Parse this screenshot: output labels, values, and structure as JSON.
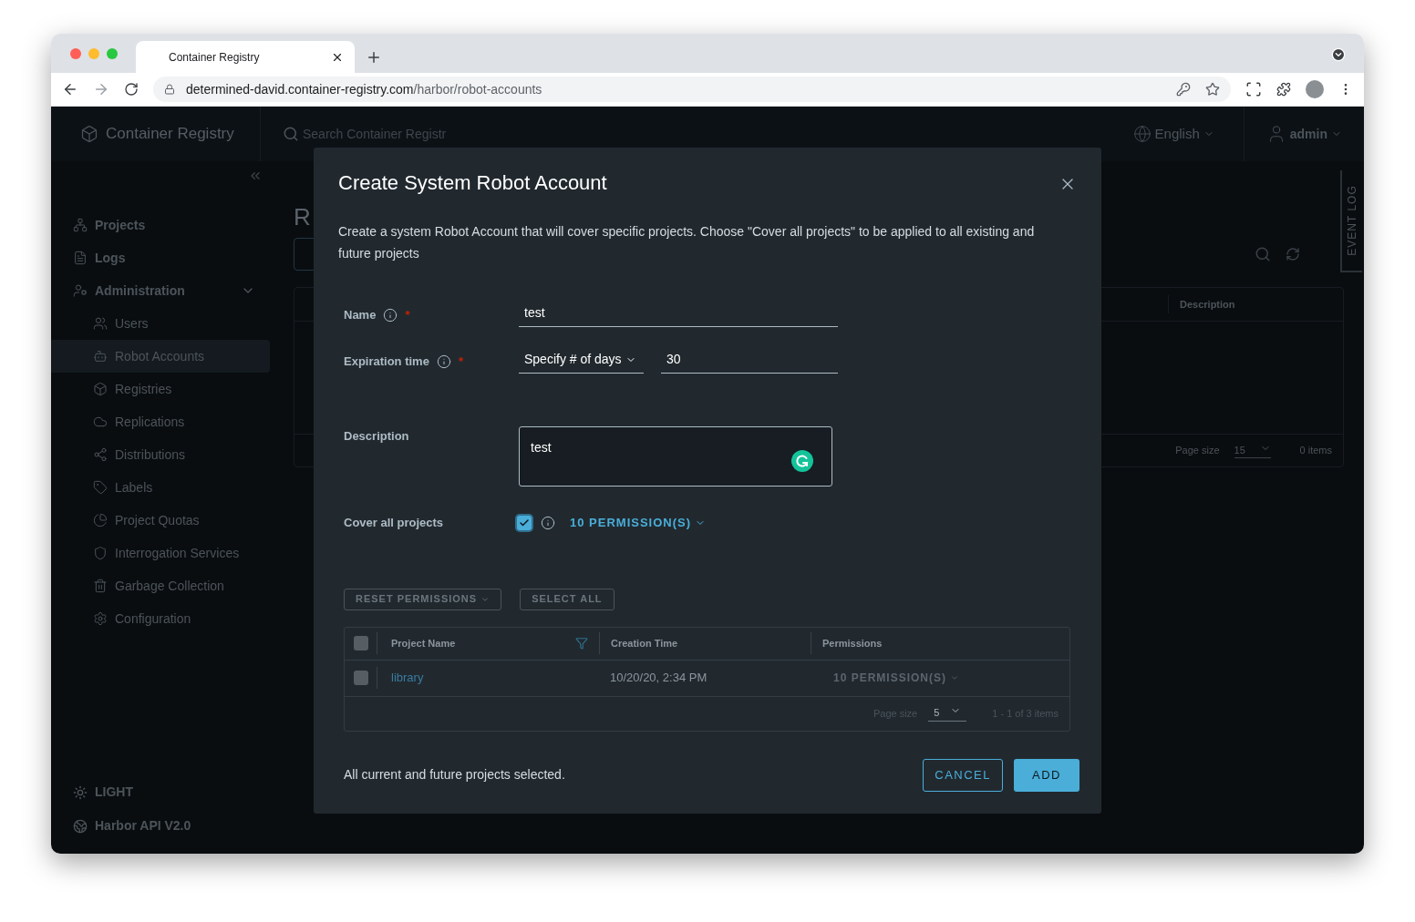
{
  "browser": {
    "tab_title": "Container Registry",
    "url_host": "determined-david.container-registry.com",
    "url_path": "/harbor/robot-accounts"
  },
  "header": {
    "brand": "Container Registry",
    "search_placeholder": "Search Container Registr",
    "language": "English",
    "user": "admin"
  },
  "sidebar": {
    "items": [
      {
        "label": "Projects",
        "selected": false
      },
      {
        "label": "Logs",
        "selected": false
      },
      {
        "label": "Administration",
        "selected": false,
        "expanded": true,
        "children": [
          {
            "label": "Users",
            "selected": false
          },
          {
            "label": "Robot Accounts",
            "selected": true
          },
          {
            "label": "Registries",
            "selected": false
          },
          {
            "label": "Replications",
            "selected": false
          },
          {
            "label": "Distributions",
            "selected": false
          },
          {
            "label": "Labels",
            "selected": false
          },
          {
            "label": "Project Quotas",
            "selected": false
          },
          {
            "label": "Interrogation Services",
            "selected": false
          },
          {
            "label": "Garbage Collection",
            "selected": false
          },
          {
            "label": "Configuration",
            "selected": false
          }
        ]
      }
    ],
    "footer": [
      "LIGHT",
      "Harbor API V2.0"
    ]
  },
  "page": {
    "title": "R",
    "table": {
      "column": "Description",
      "page_size_label": "Page size",
      "page_size": "15",
      "count": "0 items"
    },
    "event_log": "EVENT LOG"
  },
  "modal": {
    "title": "Create System Robot Account",
    "description": "Create a system Robot Account that will cover specific projects. Choose \"Cover all projects\" to be applied to all existing and future projects",
    "name": {
      "label": "Name",
      "required_mark": "*",
      "value": "test"
    },
    "expiration": {
      "label": "Expiration time",
      "required_mark": "*",
      "mode": "Specify # of days",
      "value": "30"
    },
    "description_field": {
      "label": "Description",
      "value": "test"
    },
    "cover_all": {
      "label": "Cover all projects",
      "checked": true,
      "permissions": "10 PERMISSION(S)"
    },
    "actions": [
      "RESET PERMISSIONS",
      "SELECT ALL"
    ],
    "table": {
      "select_all_checked": false,
      "columns": [
        "Project Name",
        "Creation Time",
        "Permissions"
      ],
      "rows": [
        {
          "checked": false,
          "project": "library",
          "created": "10/20/20, 2:34 PM",
          "permissions": "10 PERMISSION(S)"
        }
      ],
      "page_size_label": "Page size",
      "page_size": "5",
      "count": "1 - 1 of 3 items"
    },
    "status": "All current and future projects selected.",
    "buttons": [
      "CANCEL",
      "ADD"
    ]
  }
}
